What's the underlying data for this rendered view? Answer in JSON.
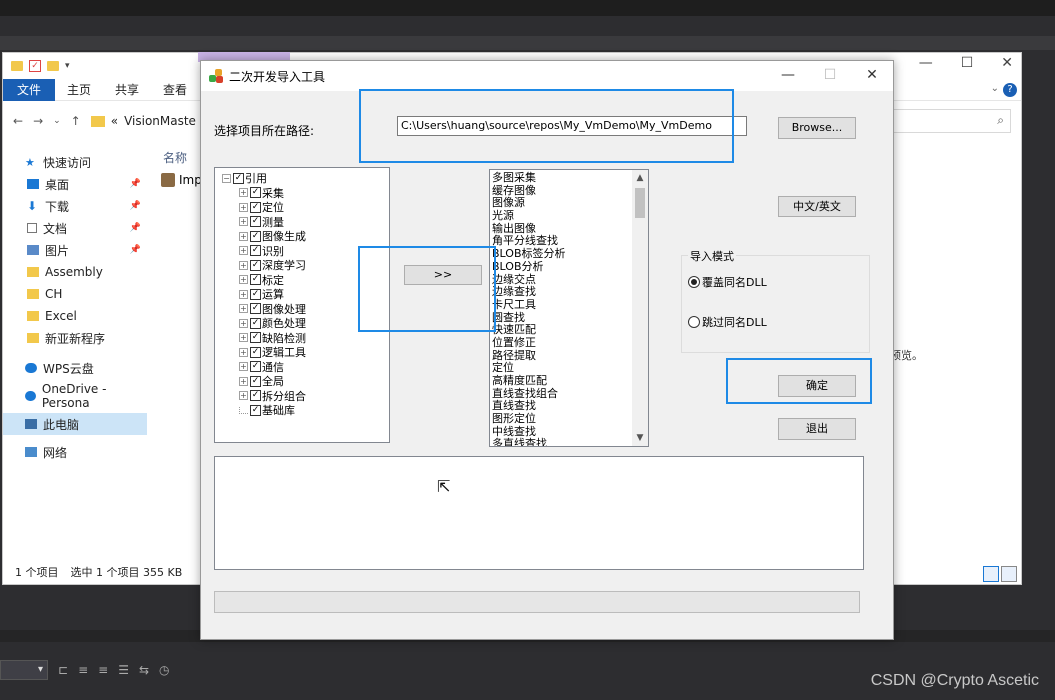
{
  "explorer": {
    "ribbon_tabs": [
      "文件",
      "主页",
      "共享",
      "查看"
    ],
    "address": "VisionMaste",
    "address_prefix": "«",
    "column_name": "名称",
    "file_partial": "Imp",
    "nav_quick": "快速访问",
    "nav_items": [
      {
        "label": "桌面",
        "icon": "desktop-icon",
        "pinned": true
      },
      {
        "label": "下载",
        "icon": "download-icon",
        "pinned": true
      },
      {
        "label": "文档",
        "icon": "document-icon",
        "pinned": true
      },
      {
        "label": "图片",
        "icon": "picture-icon",
        "pinned": true
      },
      {
        "label": "Assembly",
        "icon": "folder-icon",
        "pinned": false
      },
      {
        "label": "CH",
        "icon": "folder-icon",
        "pinned": false
      },
      {
        "label": "Excel",
        "icon": "folder-icon",
        "pinned": false
      },
      {
        "label": "新亚新程序",
        "icon": "folder-icon",
        "pinned": false
      }
    ],
    "nav_wps": "WPS云盘",
    "nav_onedrive": "OneDrive - Persona",
    "nav_pc": "此电脑",
    "nav_network": "网络",
    "status_count": "1 个项目",
    "status_selected": "选中 1 个项目  355 KB",
    "preview_note": "预览。"
  },
  "dialog": {
    "title": "二次开发导入工具",
    "path_label": "选择项目所在路径:",
    "path_value": "C:\\Users\\huang\\source\\repos\\My_VmDemo\\My_VmDemo",
    "browse_label": "Browse...",
    "lang_label": "中文/英文",
    "move_label": ">>",
    "confirm_label": "确定",
    "exit_label": "退出",
    "mode_title": "导入模式",
    "mode_options": [
      "覆盖同名DLL",
      "跳过同名DLL"
    ],
    "mode_selected": 0,
    "progress": 0,
    "tree_root": "引用",
    "tree_items": [
      "采集",
      "定位",
      "测量",
      "图像生成",
      "识别",
      "深度学习",
      "标定",
      "运算",
      "图像处理",
      "颜色处理",
      "缺陷检测",
      "逻辑工具",
      "通信",
      "全局",
      "拆分组合",
      "基础库"
    ],
    "list_items": [
      "多图采集",
      "缓存图像",
      "图像源",
      "光源",
      "输出图像",
      "角平分线查找",
      "BLOB标签分析",
      "BLOB分析",
      "边缘交点",
      "边缘查找",
      "卡尺工具",
      "圆查找",
      "快速匹配",
      "位置修正",
      "路径提取",
      "定位",
      "高精度匹配",
      "直线查找组合",
      "直线查找",
      "图形定位",
      "中线查找",
      "多直线查找"
    ]
  },
  "ide": {
    "zoom_combo": "▾"
  },
  "watermark": "CSDN @Crypto Ascetic",
  "colors": {
    "highlight": "#1e8ae6",
    "explorer_accent": "#1a5fb4",
    "ide_background": "#2d2d30"
  }
}
